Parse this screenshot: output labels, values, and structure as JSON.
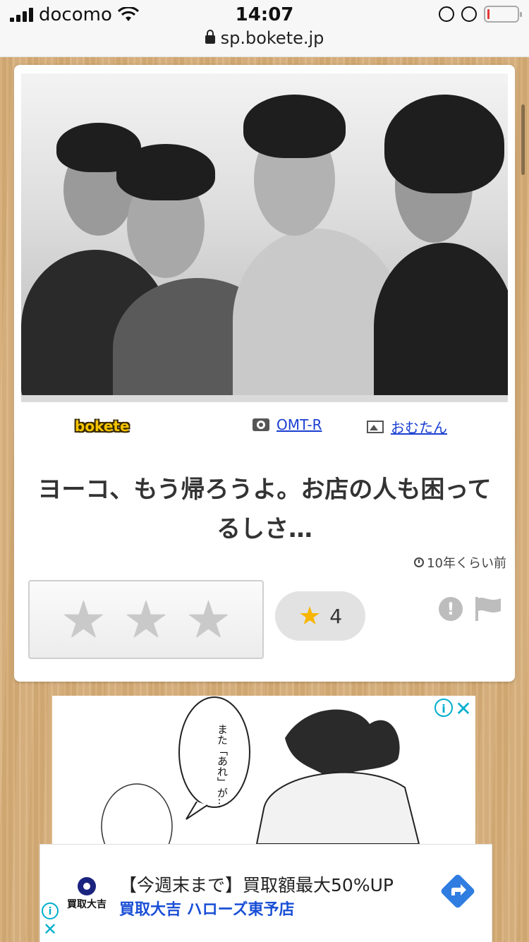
{
  "status_bar": {
    "carrier": "docomo",
    "time": "14:07",
    "url": "sp.bokete.jp"
  },
  "post": {
    "logo": "bokete",
    "photographer": "OMT-R",
    "image_author": "おむたん",
    "caption": "ヨーコ、もう帰ろうよ。お店の人も困ってるしさ…",
    "time_ago": "10年くらい前",
    "star_count": "4",
    "rating_stars": [
      "★",
      "★",
      "★"
    ],
    "count_star_icon": "★",
    "report_icon": "!"
  },
  "manga_ad": {
    "speech": "また「あれ」が…"
  },
  "banner_ad": {
    "brand_logo_text": "買取大吉",
    "title": "【今週末まで】買取額最大50%UP",
    "subtitle": "買取大吉 ハローズ東予店"
  },
  "ad_controls": {
    "info": "i",
    "close": "✕"
  },
  "colors": {
    "link": "#1a3fd1",
    "ad_accent": "#00aecd",
    "star_active": "#f7b500",
    "wood_bg": "#d9b07a"
  }
}
